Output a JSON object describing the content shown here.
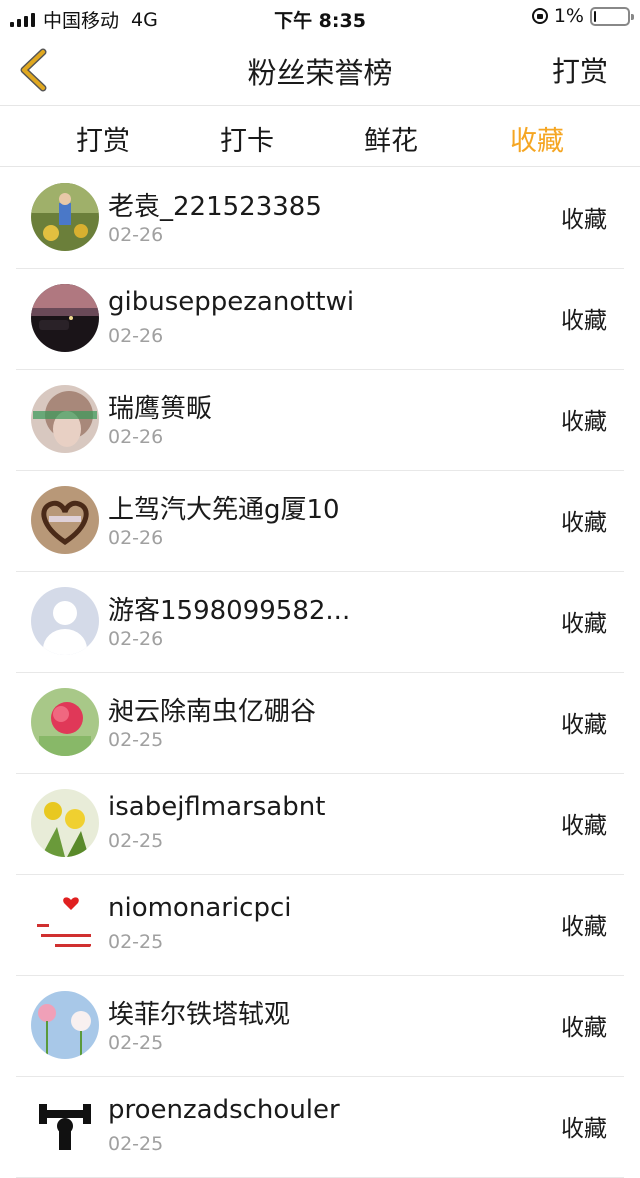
{
  "status_bar": {
    "carrier": "中国移动",
    "network": "4G",
    "time": "下午 8:35",
    "battery_percent": "1%",
    "battery_level": 0.05
  },
  "nav": {
    "back_icon": "chevron-left-icon",
    "title": "粉丝荣誉榜",
    "right_label": "打赏"
  },
  "tabs": [
    {
      "label": "打赏",
      "active": false
    },
    {
      "label": "打卡",
      "active": false
    },
    {
      "label": "鲜花",
      "active": false
    },
    {
      "label": "收藏",
      "active": true
    }
  ],
  "colors": {
    "accent": "#f5a623",
    "back_icon": "#e0a820"
  },
  "rows": [
    {
      "name": "老袁_221523385",
      "date": "02-26",
      "action": "收藏"
    },
    {
      "name": "gibuseppezanottwi",
      "date": "02-26",
      "action": "收藏"
    },
    {
      "name": "瑞鹰篑畈",
      "date": "02-26",
      "action": "收藏"
    },
    {
      "name": "上驾汽大筅通g厦10",
      "date": "02-26",
      "action": "收藏"
    },
    {
      "name": "游客1598099582...",
      "date": "02-26",
      "action": "收藏"
    },
    {
      "name": "昶云除南虫亿硼谷",
      "date": "02-25",
      "action": "收藏"
    },
    {
      "name": "isabejflmarsabnt",
      "date": "02-25",
      "action": "收藏"
    },
    {
      "name": "niomonaricpci",
      "date": "02-25",
      "action": "收藏"
    },
    {
      "name": "埃菲尔铁塔轼观",
      "date": "02-25",
      "action": "收藏"
    },
    {
      "name": "proenzadschouler",
      "date": "02-25",
      "action": "收藏"
    }
  ]
}
